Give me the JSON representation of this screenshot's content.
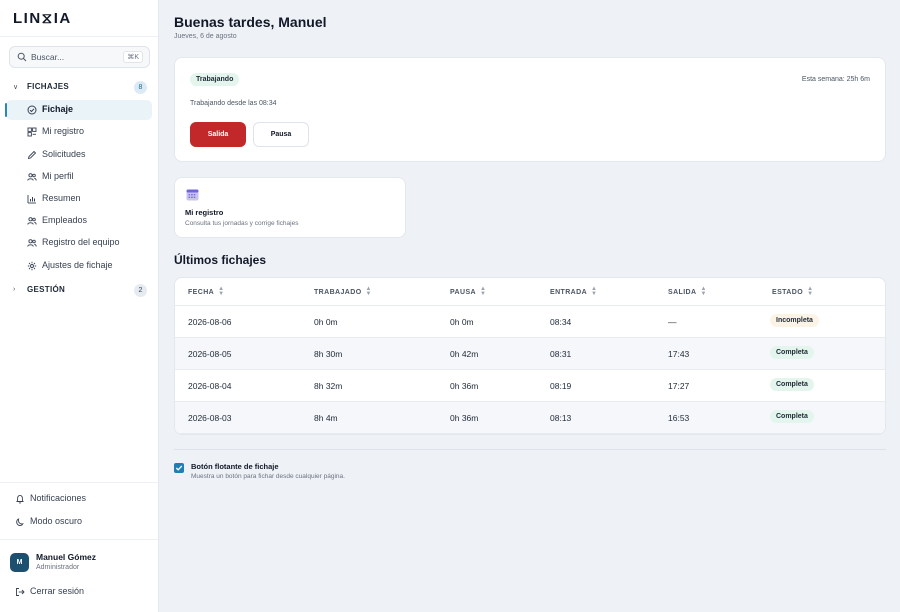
{
  "brand": {
    "logo": "LIN⧖IA"
  },
  "search": {
    "placeholder": "Buscar...",
    "shortcut": "⌘K"
  },
  "sidebar": {
    "groups": [
      {
        "label": "FICHAJES",
        "count": "8",
        "expanded": true
      },
      {
        "label": "GESTIÓN",
        "count": "2",
        "expanded": false
      }
    ],
    "items": [
      {
        "label": "Fichaje",
        "icon": "check-circle-icon",
        "active": true
      },
      {
        "label": "Mi registro",
        "icon": "layout-icon"
      },
      {
        "label": "Solicitudes",
        "icon": "pencil-icon"
      },
      {
        "label": "Mi perfil",
        "icon": "users-icon"
      },
      {
        "label": "Resumen",
        "icon": "bar-chart-icon"
      },
      {
        "label": "Empleados",
        "icon": "users-icon"
      },
      {
        "label": "Registro del equipo",
        "icon": "users-icon"
      },
      {
        "label": "Ajustes de fichaje",
        "icon": "gear-icon"
      }
    ],
    "bottom": {
      "notifications": "Notificaciones",
      "dark_mode": "Modo oscuro",
      "logout": "Cerrar sesión"
    },
    "user": {
      "initials": "M",
      "name": "Manuel Gómez",
      "role": "Administrador"
    }
  },
  "header": {
    "greeting": "Buenas tardes, Manuel",
    "date": "Jueves, 6 de agosto"
  },
  "status_card": {
    "badge": "Trabajando",
    "week": "Esta semana: 25h 6m",
    "since": "Trabajando desde las 08:34",
    "exit_button": "Salida",
    "pause_button": "Pausa",
    "exit_color": "#c2282a"
  },
  "shortcut_card": {
    "title": "Mi registro",
    "subtitle": "Consulta tus jornadas y corrige fichajes"
  },
  "recent": {
    "title": "Últimos fichajes",
    "columns": [
      "FECHA",
      "TRABAJADO",
      "PAUSA",
      "ENTRADA",
      "SALIDA",
      "ESTADO"
    ],
    "rows": [
      {
        "fecha": "2026-08-06",
        "trabajado": "0h 0m",
        "pausa": "0h 0m",
        "entrada": "08:34",
        "salida": "—",
        "estado": "Incompleta"
      },
      {
        "fecha": "2026-08-05",
        "trabajado": "8h 30m",
        "pausa": "0h 42m",
        "entrada": "08:31",
        "salida": "17:43",
        "estado": "Completa"
      },
      {
        "fecha": "2026-08-04",
        "trabajado": "8h 32m",
        "pausa": "0h 36m",
        "entrada": "08:19",
        "salida": "17:27",
        "estado": "Completa"
      },
      {
        "fecha": "2026-08-03",
        "trabajado": "8h 4m",
        "pausa": "0h 36m",
        "entrada": "08:13",
        "salida": "16:53",
        "estado": "Completa"
      }
    ]
  },
  "floating": {
    "checked": true,
    "title": "Botón flotante de fichaje",
    "subtitle": "Muestra un botón para fichar desde cualquier página."
  }
}
